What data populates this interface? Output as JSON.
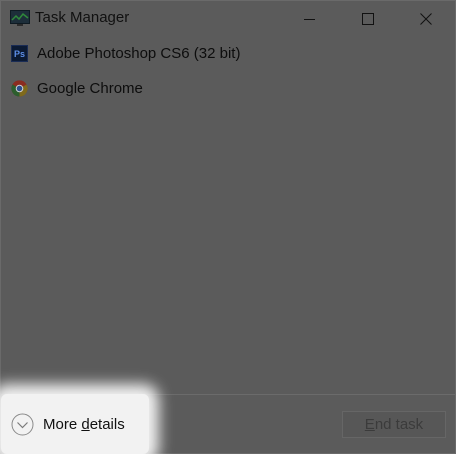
{
  "window": {
    "title": "Task Manager",
    "app_icon": "task-manager-icon",
    "caption_buttons": [
      "minimize-icon",
      "maximize-icon",
      "close-icon"
    ]
  },
  "processes": [
    {
      "name": "Adobe Photoshop CS6 (32 bit)",
      "icon": "photoshop-icon",
      "icon_text": "Ps"
    },
    {
      "name": "Google Chrome",
      "icon": "chrome-icon"
    }
  ],
  "footer": {
    "more_details_pre": "More ",
    "more_details_accel": "d",
    "more_details_post": "etails",
    "end_task_accel": "E",
    "end_task_post": "nd task",
    "end_task_enabled": false
  },
  "colors": {
    "dimmed_background": "#5b5b5b",
    "highlight": "#f2f2f2"
  }
}
